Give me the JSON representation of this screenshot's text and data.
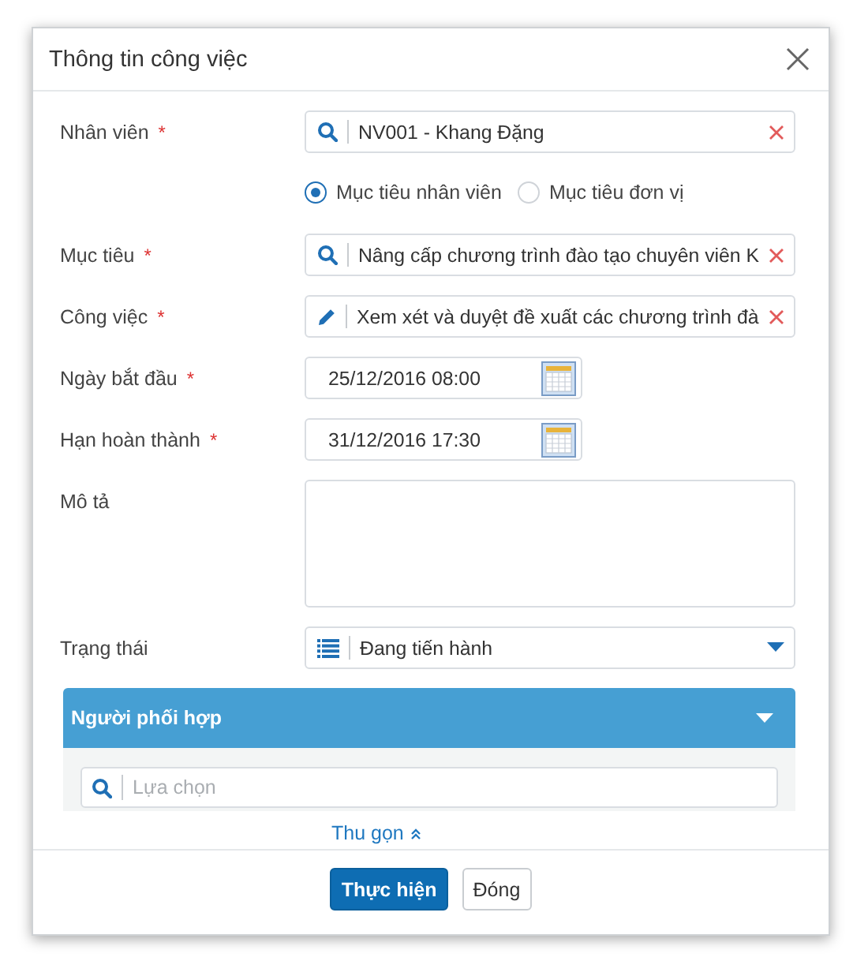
{
  "dialog": {
    "title": "Thông tin công việc"
  },
  "fields": [
    {
      "kind": "lookup",
      "label": "Nhân viên",
      "required_mark": "*",
      "value": "NV001 - Khang Đặng",
      "clearable": true
    },
    {
      "kind": "radio",
      "options": [
        {
          "label": "Mục tiêu nhân viên",
          "selected": true
        },
        {
          "label": "Mục tiêu đơn vị",
          "selected": false
        }
      ]
    },
    {
      "kind": "lookup",
      "label": "Mục tiêu",
      "required_mark": "*",
      "value": "Nâng cấp chương trình đào tạo chuyên viên K",
      "clearable": true
    },
    {
      "kind": "text",
      "label": "Công việc",
      "required_mark": "*",
      "value": "Xem xét và duyệt đề xuất các chương trình đà",
      "clearable": true
    },
    {
      "kind": "date",
      "label": "Ngày bắt đầu",
      "required_mark": "*",
      "value": "25/12/2016 08:00"
    },
    {
      "kind": "date",
      "label": "Hạn hoàn thành",
      "required_mark": "*",
      "value": "31/12/2016 17:30"
    },
    {
      "kind": "textarea",
      "label": "Mô tả"
    },
    {
      "kind": "select",
      "label": "Trạng thái",
      "value": "Đang tiến hành"
    }
  ],
  "panel": {
    "title": "Người phối hợp",
    "expanded": true,
    "search": {
      "placeholder": "Lựa chọn"
    }
  },
  "collapse_link": "Thu gọn",
  "buttons": [
    {
      "label": "Thực hiện",
      "kind": "primary"
    },
    {
      "label": "Đóng",
      "kind": "default"
    }
  ]
}
